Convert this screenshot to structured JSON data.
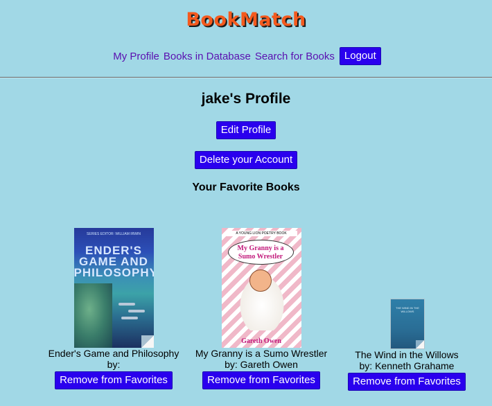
{
  "brand": {
    "title": "BookMatch"
  },
  "nav": {
    "items": [
      {
        "label": "My Profile"
      },
      {
        "label": "Books in Database"
      },
      {
        "label": "Search for Books"
      }
    ],
    "logout_label": "Logout"
  },
  "profile": {
    "title": "jake's Profile",
    "edit_label": "Edit Profile",
    "delete_label": "Delete your Account",
    "favorites_heading": "Your Favorite Books"
  },
  "books": [
    {
      "title": "Ender's Game and Philosophy",
      "author": "by:",
      "remove_label": "Remove from Favorites",
      "cover": {
        "top_text": "SERIES EDITOR: WILLIAM IRWIN",
        "title_text": "ENDER'S GAME AND PHILOSOPHY"
      }
    },
    {
      "title": "My Granny is a Sumo Wrestler",
      "author": "by: Gareth Owen",
      "remove_label": "Remove from Favorites",
      "cover": {
        "top_text": "A YOUNG LION POETRY BOOK",
        "title_text": "My Granny is a Sumo Wrestler",
        "author_text": "Gareth Owen"
      }
    },
    {
      "title": "The Wind in the Willows",
      "author": "by: Kenneth Grahame",
      "remove_label": "Remove from Favorites",
      "cover": {
        "title_text": "THE WIND IN THE WILLOWS"
      }
    }
  ],
  "colors": {
    "background": "#a1d8e6",
    "brand": "#f45a1e",
    "link": "#5a0fb0",
    "button": "#2a00ee"
  }
}
